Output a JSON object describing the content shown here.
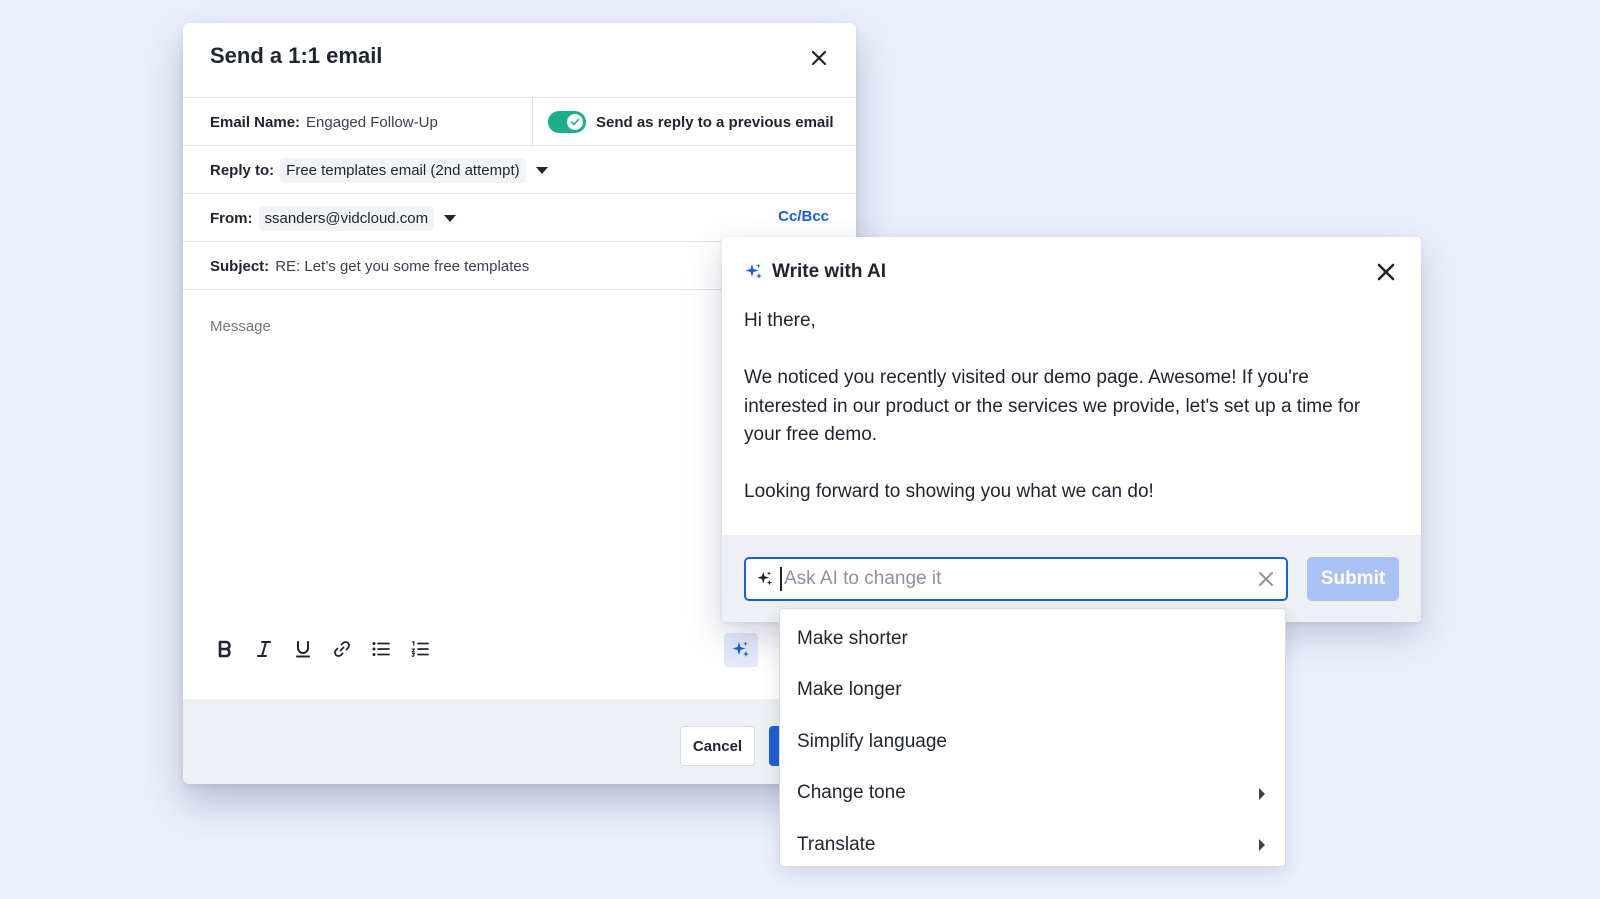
{
  "email_dialog": {
    "title": "Send a 1:1 email",
    "email_name_label": "Email Name:",
    "email_name_value": "Engaged Follow-Up",
    "reply_toggle_label": "Send as reply to a previous email",
    "reply_toggle_on": true,
    "reply_to_label": "Reply to:",
    "reply_to_value": "Free templates email (2nd attempt)",
    "from_label": "From:",
    "from_value": "ssanders@vidcloud.com",
    "ccbcc_label": "Cc/Bcc",
    "subject_label": "Subject:",
    "subject_value": "RE: Let’s get you some free templates",
    "message_placeholder": "Message",
    "cancel_label": "Cancel"
  },
  "ai_panel": {
    "title": "Write with AI",
    "body_paragraphs": [
      "Hi there,",
      "We noticed you recently visited our demo page. Awesome! If you're interested in our product or the services we provide, let's set up a time for your free demo.",
      "Looking forward to showing you what we can do!"
    ],
    "input_placeholder": "Ask AI to change it",
    "input_value": "",
    "submit_label": "Submit"
  },
  "suggestions": [
    {
      "label": "Make shorter",
      "has_submenu": false
    },
    {
      "label": "Make longer",
      "has_submenu": false
    },
    {
      "label": "Simplify language",
      "has_submenu": false
    },
    {
      "label": "Change tone",
      "has_submenu": true
    },
    {
      "label": "Translate",
      "has_submenu": true
    }
  ],
  "icons": {
    "close": "close-icon",
    "toggle_check": "check-icon",
    "ai_sparkle": "sparkle-icon",
    "toolbar": [
      "bold-icon",
      "italic-icon",
      "underline-icon",
      "link-icon",
      "bullet-list-icon",
      "numbered-list-icon"
    ]
  },
  "colors": {
    "background": "#ecf0fd",
    "accent": "#1b5fd6",
    "toggle_on": "#1cae8b",
    "submit_disabled": "#a8c2f5",
    "footer_bg": "#edf0f4"
  }
}
